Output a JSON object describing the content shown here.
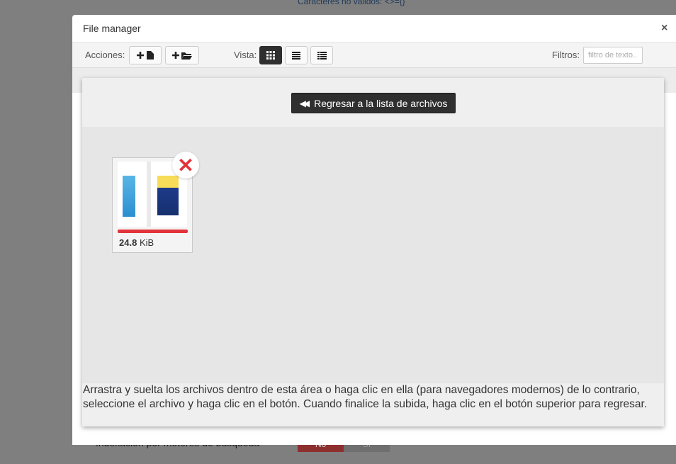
{
  "background": {
    "top_text": "Caracteres no válidos: <>={}",
    "bottom_text": "Indexación por motores de búsqueda",
    "toggle_no": "No",
    "toggle_si": "Sí"
  },
  "modal": {
    "title": "File manager",
    "close_label": "×"
  },
  "toolbar": {
    "actions_label": "Acciones:",
    "view_label": "Vista:",
    "filters_label": "Filtros:",
    "filter_placeholder": "filtro de texto...",
    "active_view": "grid"
  },
  "upload": {
    "back_button": "Regresar a la lista de archivos",
    "hint": "Arrastra y suelta los archivos dentro de esta área o haga clic en ella (para navegadores modernos) de lo contrario, seleccione el archivo y haga clic en el botón. Cuando finalice la subida, haga clic en el botón superior para regresar.",
    "file": {
      "size_value": "24.8",
      "size_unit": "KiB",
      "progress": 1.0,
      "status_color": "#e2333b"
    }
  },
  "colors": {
    "accent_dark": "#2f2f2f",
    "error": "#e2333b"
  }
}
